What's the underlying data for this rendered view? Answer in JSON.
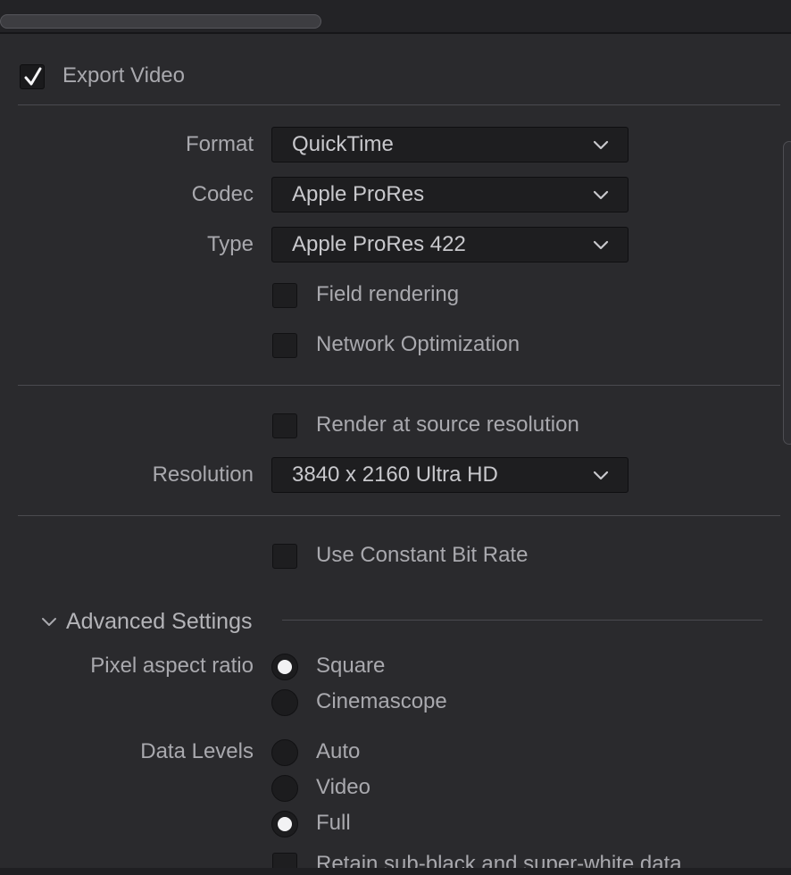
{
  "export_video": {
    "label": "Export Video",
    "checked": true
  },
  "video": {
    "format": {
      "label": "Format",
      "value": "QuickTime"
    },
    "codec": {
      "label": "Codec",
      "value": "Apple ProRes"
    },
    "type": {
      "label": "Type",
      "value": "Apple ProRes 422"
    },
    "field_rendering": {
      "label": "Field rendering",
      "checked": false
    },
    "network_optimization": {
      "label": "Network Optimization",
      "checked": false
    }
  },
  "resolution_section": {
    "render_at_source": {
      "label": "Render at source resolution",
      "checked": false
    },
    "resolution": {
      "label": "Resolution",
      "value": "3840 x 2160 Ultra HD"
    }
  },
  "bitrate": {
    "use_constant_bit_rate": {
      "label": "Use Constant Bit Rate",
      "checked": false
    }
  },
  "advanced": {
    "title": "Advanced Settings",
    "pixel_aspect_ratio": {
      "label": "Pixel aspect ratio",
      "options": [
        "Square",
        "Cinemascope"
      ],
      "selected": "Square"
    },
    "data_levels": {
      "label": "Data Levels",
      "options": [
        "Auto",
        "Video",
        "Full"
      ],
      "selected": "Full"
    },
    "retain_sub_black": {
      "label": "Retain sub-black and super-white data",
      "checked": false
    }
  }
}
